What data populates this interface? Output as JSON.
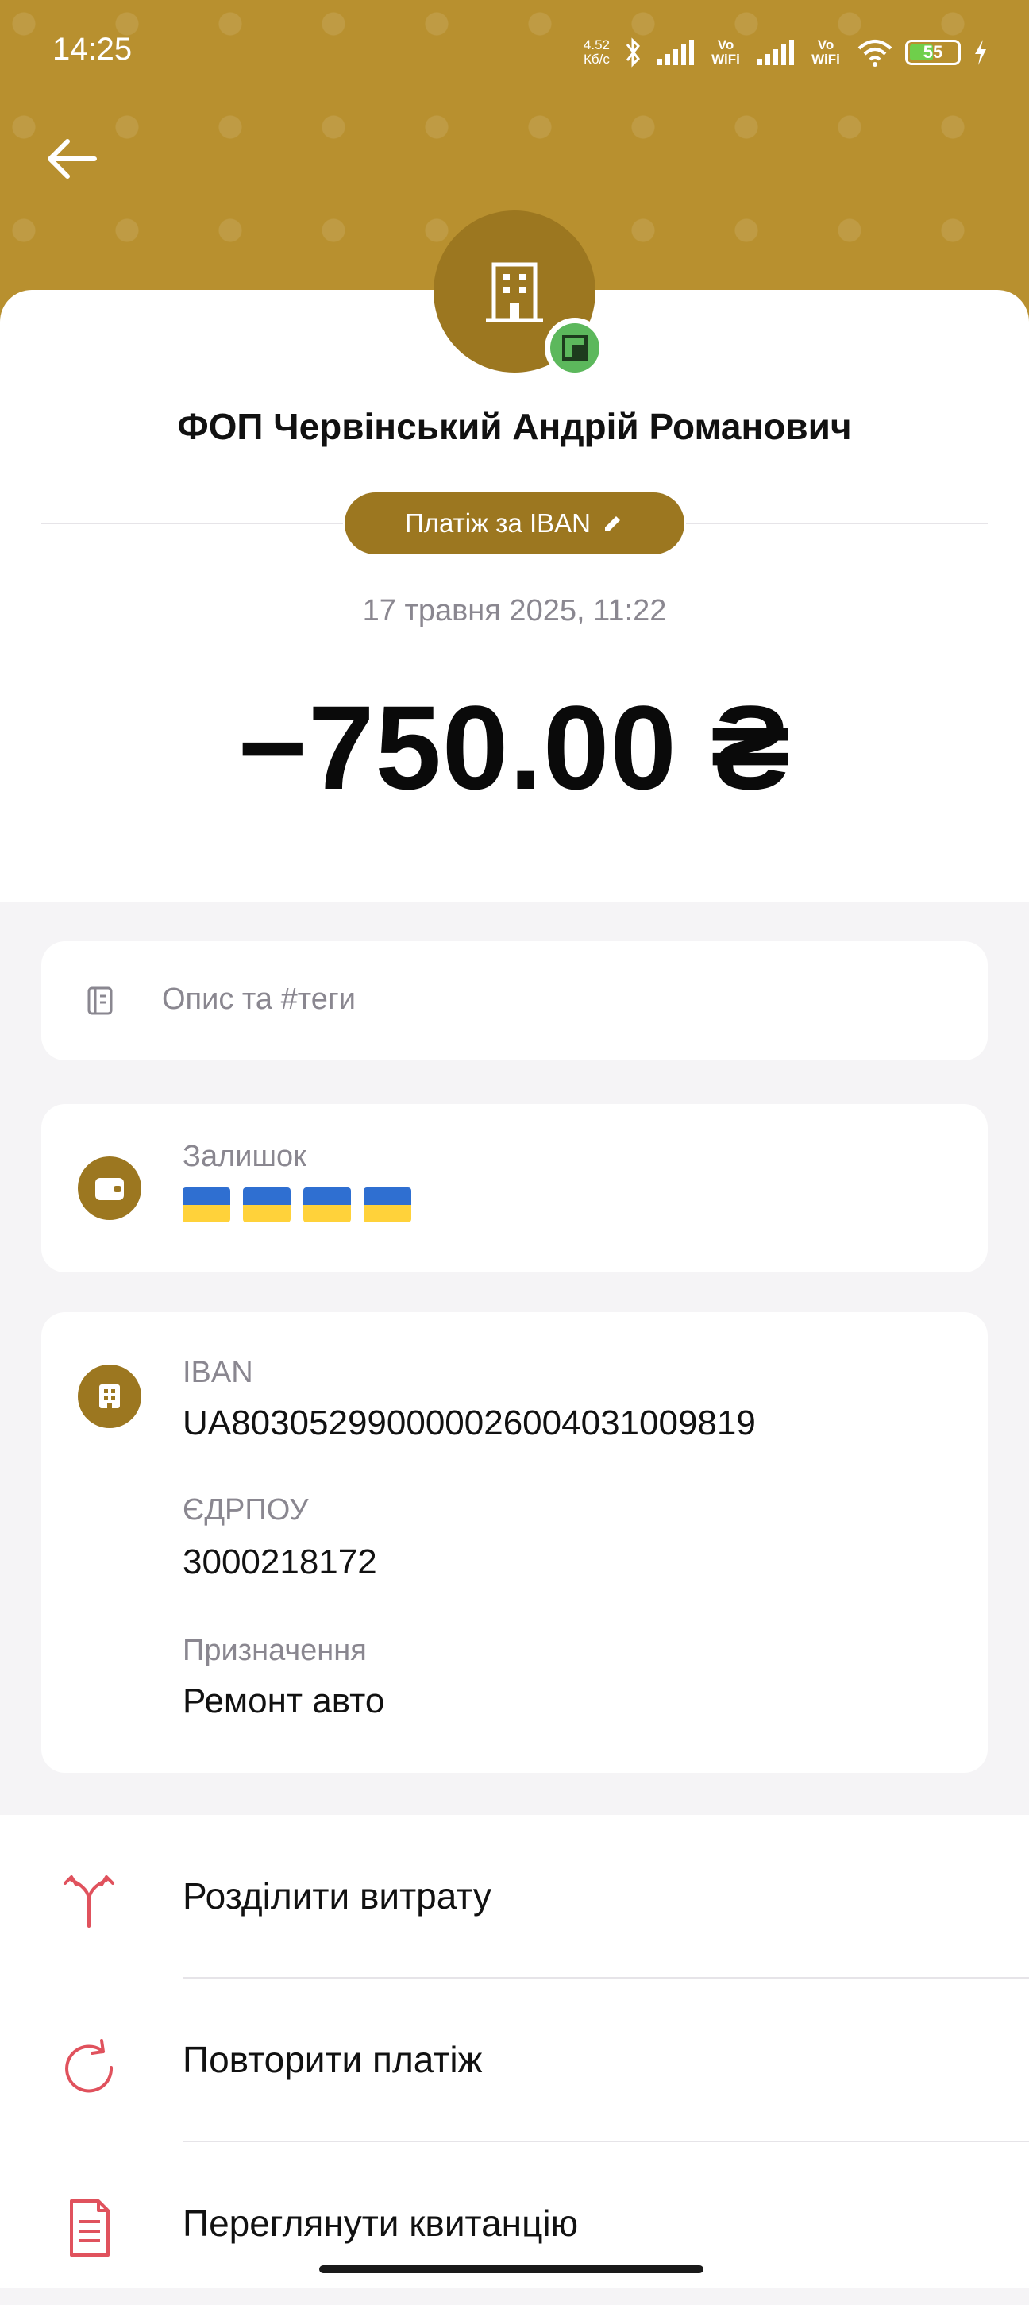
{
  "status_bar": {
    "time": "14:25",
    "net_speed_value": "4.52",
    "net_speed_unit": "Кб/с",
    "vo_wifi_1": "Vo WiFi",
    "vo_wifi_2": "Vo WiFi",
    "battery_level": "55",
    "battery_fraction": 0.55
  },
  "transaction": {
    "merchant_name": "ФОП Червінський Андрій Романович",
    "payment_type": "Платіж за IBAN",
    "datetime": "17 травня 2025, 11:22",
    "amount": "−750.00 ₴"
  },
  "description": {
    "placeholder": "Опис та #теги"
  },
  "balance": {
    "label": "Залишок",
    "flag_count": 4
  },
  "details": {
    "iban_label": "IBAN",
    "iban_value": "UA803052990000026004031009819",
    "edrpou_label": "ЄДРПОУ",
    "edrpou_value": "3000218172",
    "purpose_label": "Призначення",
    "purpose_value": "Ремонт авто"
  },
  "actions": [
    {
      "label": "Розділити витрату",
      "icon": "split-icon"
    },
    {
      "label": "Повторити платіж",
      "icon": "repeat-icon"
    },
    {
      "label": "Переглянути квитанцію",
      "icon": "receipt-icon"
    }
  ],
  "colors": {
    "brand_gold": "#b8902f",
    "accent_gold_dark": "#9c7720",
    "action_icon_red": "#e0525d",
    "bank_badge_green": "#5cb85c",
    "flag_blue": "#2f6fd1",
    "flag_yellow": "#ffd23a"
  }
}
